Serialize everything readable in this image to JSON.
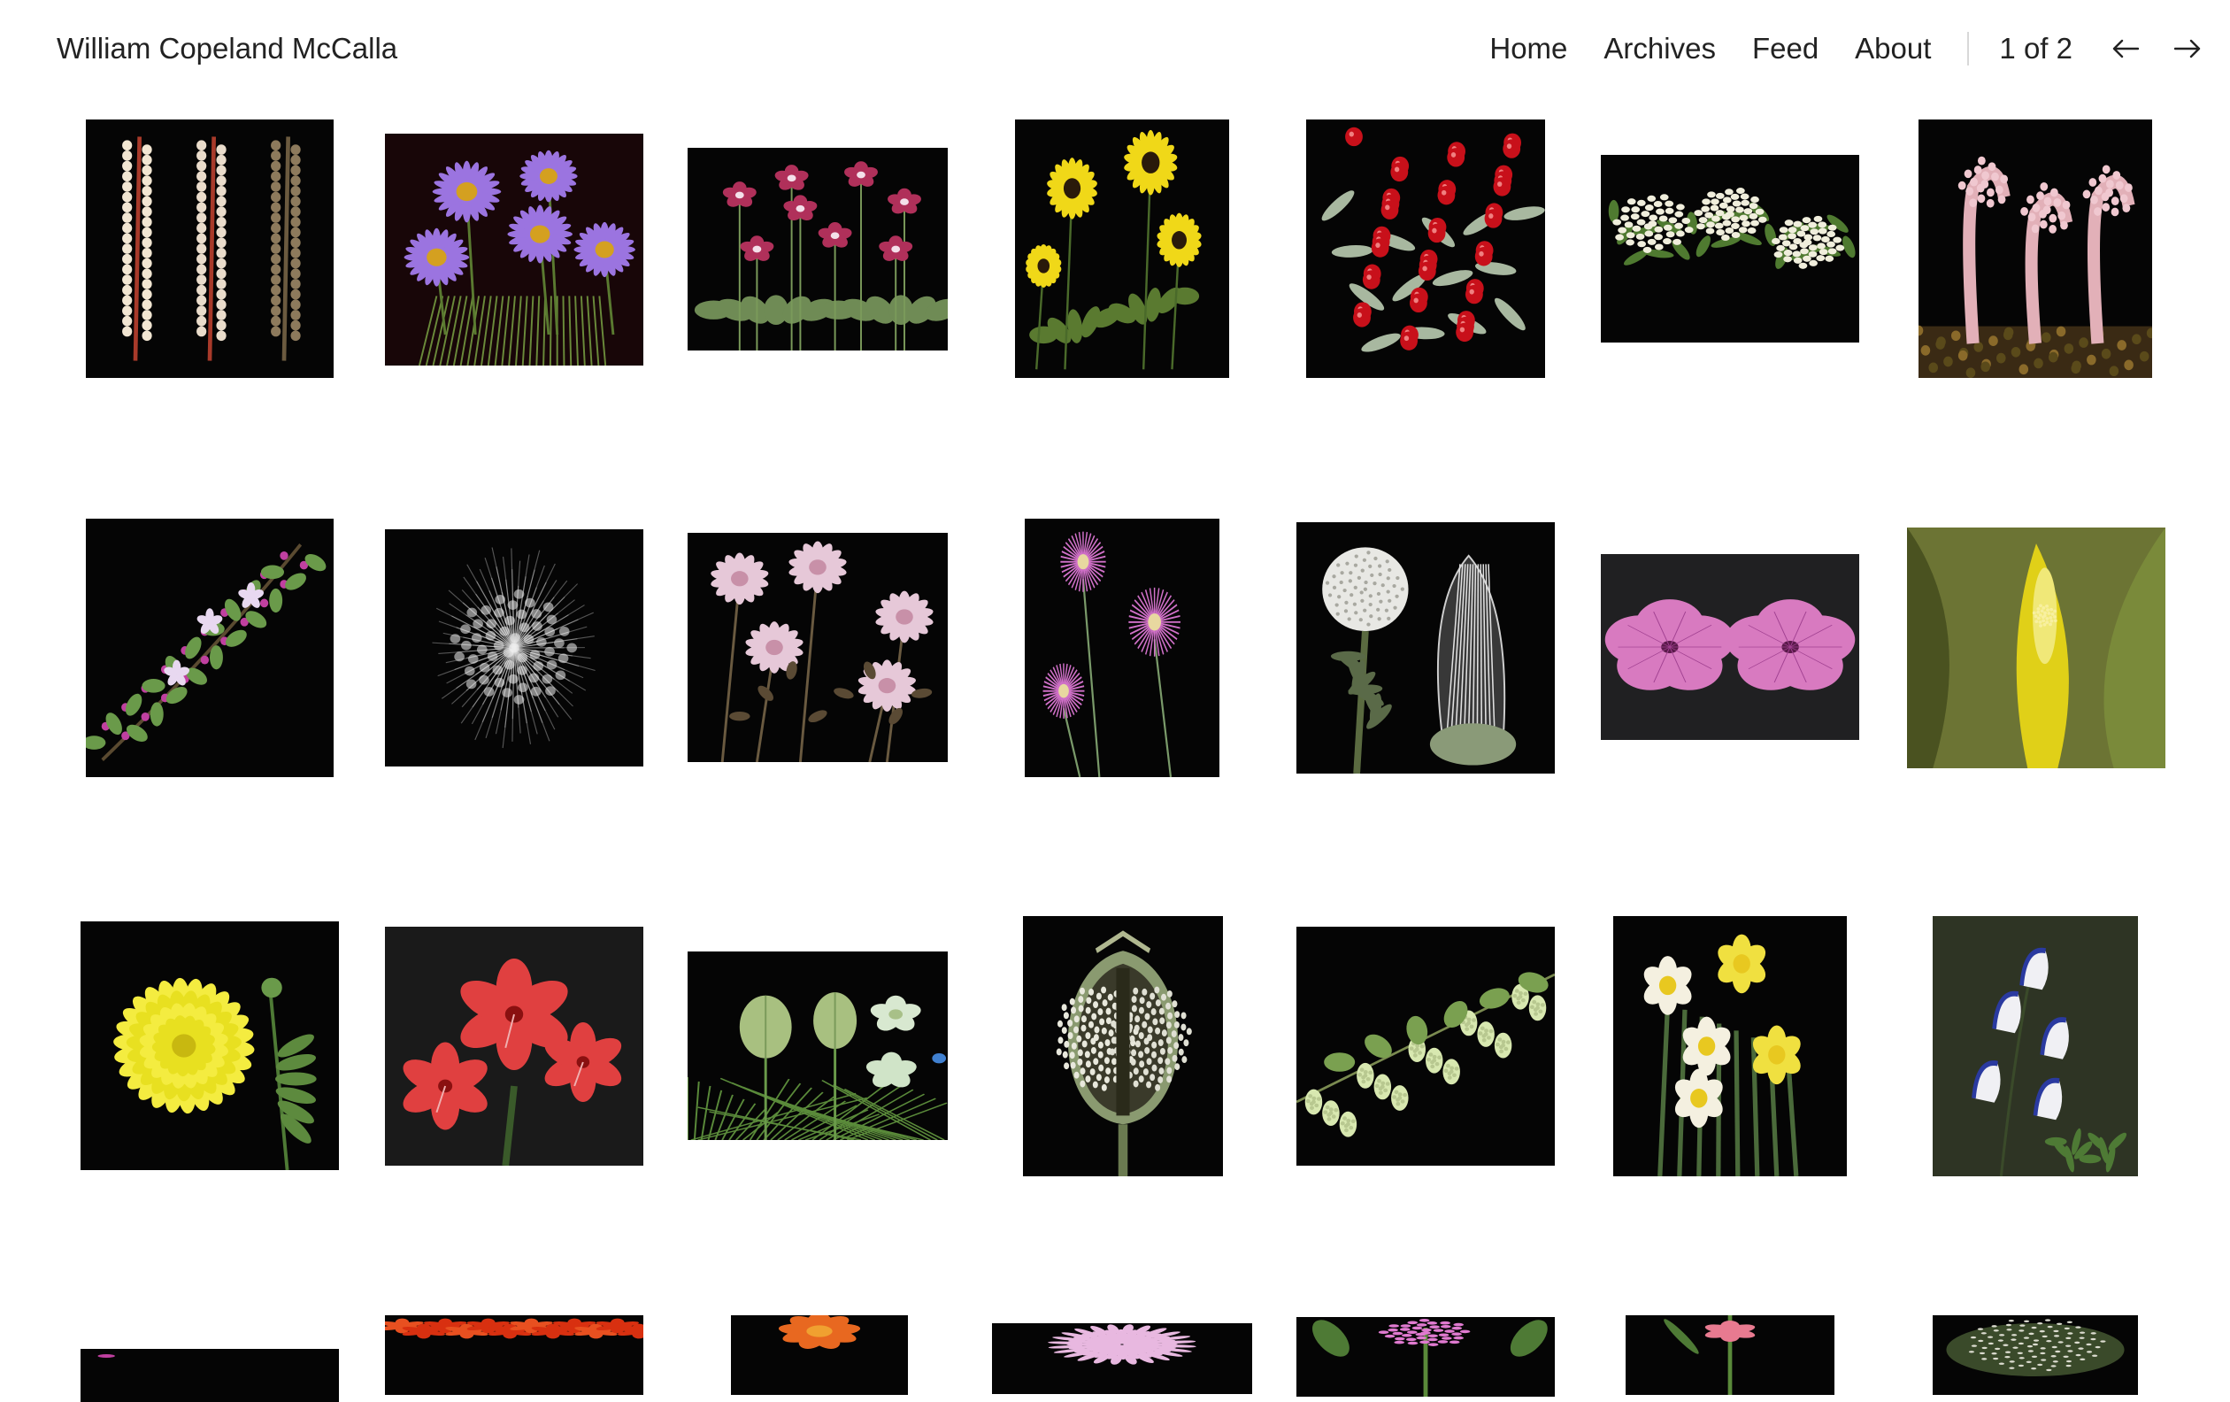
{
  "site": {
    "title": "William Copeland McCalla"
  },
  "nav": {
    "links": [
      {
        "label": "Home"
      },
      {
        "label": "Archives"
      },
      {
        "label": "Feed"
      },
      {
        "label": "About"
      }
    ],
    "pagination": {
      "current": 1,
      "total": 2,
      "label": "1 of 2"
    },
    "prev_icon": "arrow-left-icon",
    "next_icon": "arrow-right-icon"
  },
  "gallery": {
    "rows_visible": 4,
    "columns": 7,
    "photos": [
      {
        "name": "photo-white-spike-stalks",
        "subject": "spike"
      },
      {
        "name": "photo-purple-asters",
        "subject": "aster"
      },
      {
        "name": "photo-pink-phlox-cluster",
        "subject": "cluster-pink"
      },
      {
        "name": "photo-yellow-sunflowers",
        "subject": "sunflower"
      },
      {
        "name": "photo-red-berries",
        "subject": "berries"
      },
      {
        "name": "photo-white-yarrow-fern",
        "subject": "yarrow"
      },
      {
        "name": "photo-pink-curled-stems",
        "subject": "curl"
      },
      {
        "name": "photo-lilac-sprigs",
        "subject": "sprig"
      },
      {
        "name": "photo-white-seed-fluff",
        "subject": "fluff"
      },
      {
        "name": "photo-clover-blossoms",
        "subject": "clover"
      },
      {
        "name": "photo-pink-thistle-flowers",
        "subject": "thistle"
      },
      {
        "name": "photo-dandelion-seedhead",
        "subject": "seedhead"
      },
      {
        "name": "photo-pink-mallow-pair",
        "subject": "mallow"
      },
      {
        "name": "photo-yellow-skunk-cabbage",
        "subject": "spathe"
      },
      {
        "name": "photo-yellow-dahlia",
        "subject": "dahlia"
      },
      {
        "name": "photo-red-gladiolus",
        "subject": "gladiolus"
      },
      {
        "name": "photo-green-seed-pods",
        "subject": "pods"
      },
      {
        "name": "photo-poppy-pod-section",
        "subject": "poppy-pod"
      },
      {
        "name": "photo-hop-cones",
        "subject": "hops"
      },
      {
        "name": "photo-daffodils",
        "subject": "daffodil"
      },
      {
        "name": "photo-blue-monkshood",
        "subject": "monkshood"
      },
      {
        "name": "photo-pink-partial",
        "subject": "pink-partial"
      },
      {
        "name": "photo-red-tulips",
        "subject": "red-cluster"
      },
      {
        "name": "photo-orange-parrot-tulip",
        "subject": "orange"
      },
      {
        "name": "photo-pink-chrysanthemum",
        "subject": "mum"
      },
      {
        "name": "photo-pink-hyacinth",
        "subject": "hyacinth"
      },
      {
        "name": "photo-pink-gladiolus",
        "subject": "pink-glad"
      },
      {
        "name": "photo-seed-cross-section",
        "subject": "seed-section"
      }
    ]
  }
}
